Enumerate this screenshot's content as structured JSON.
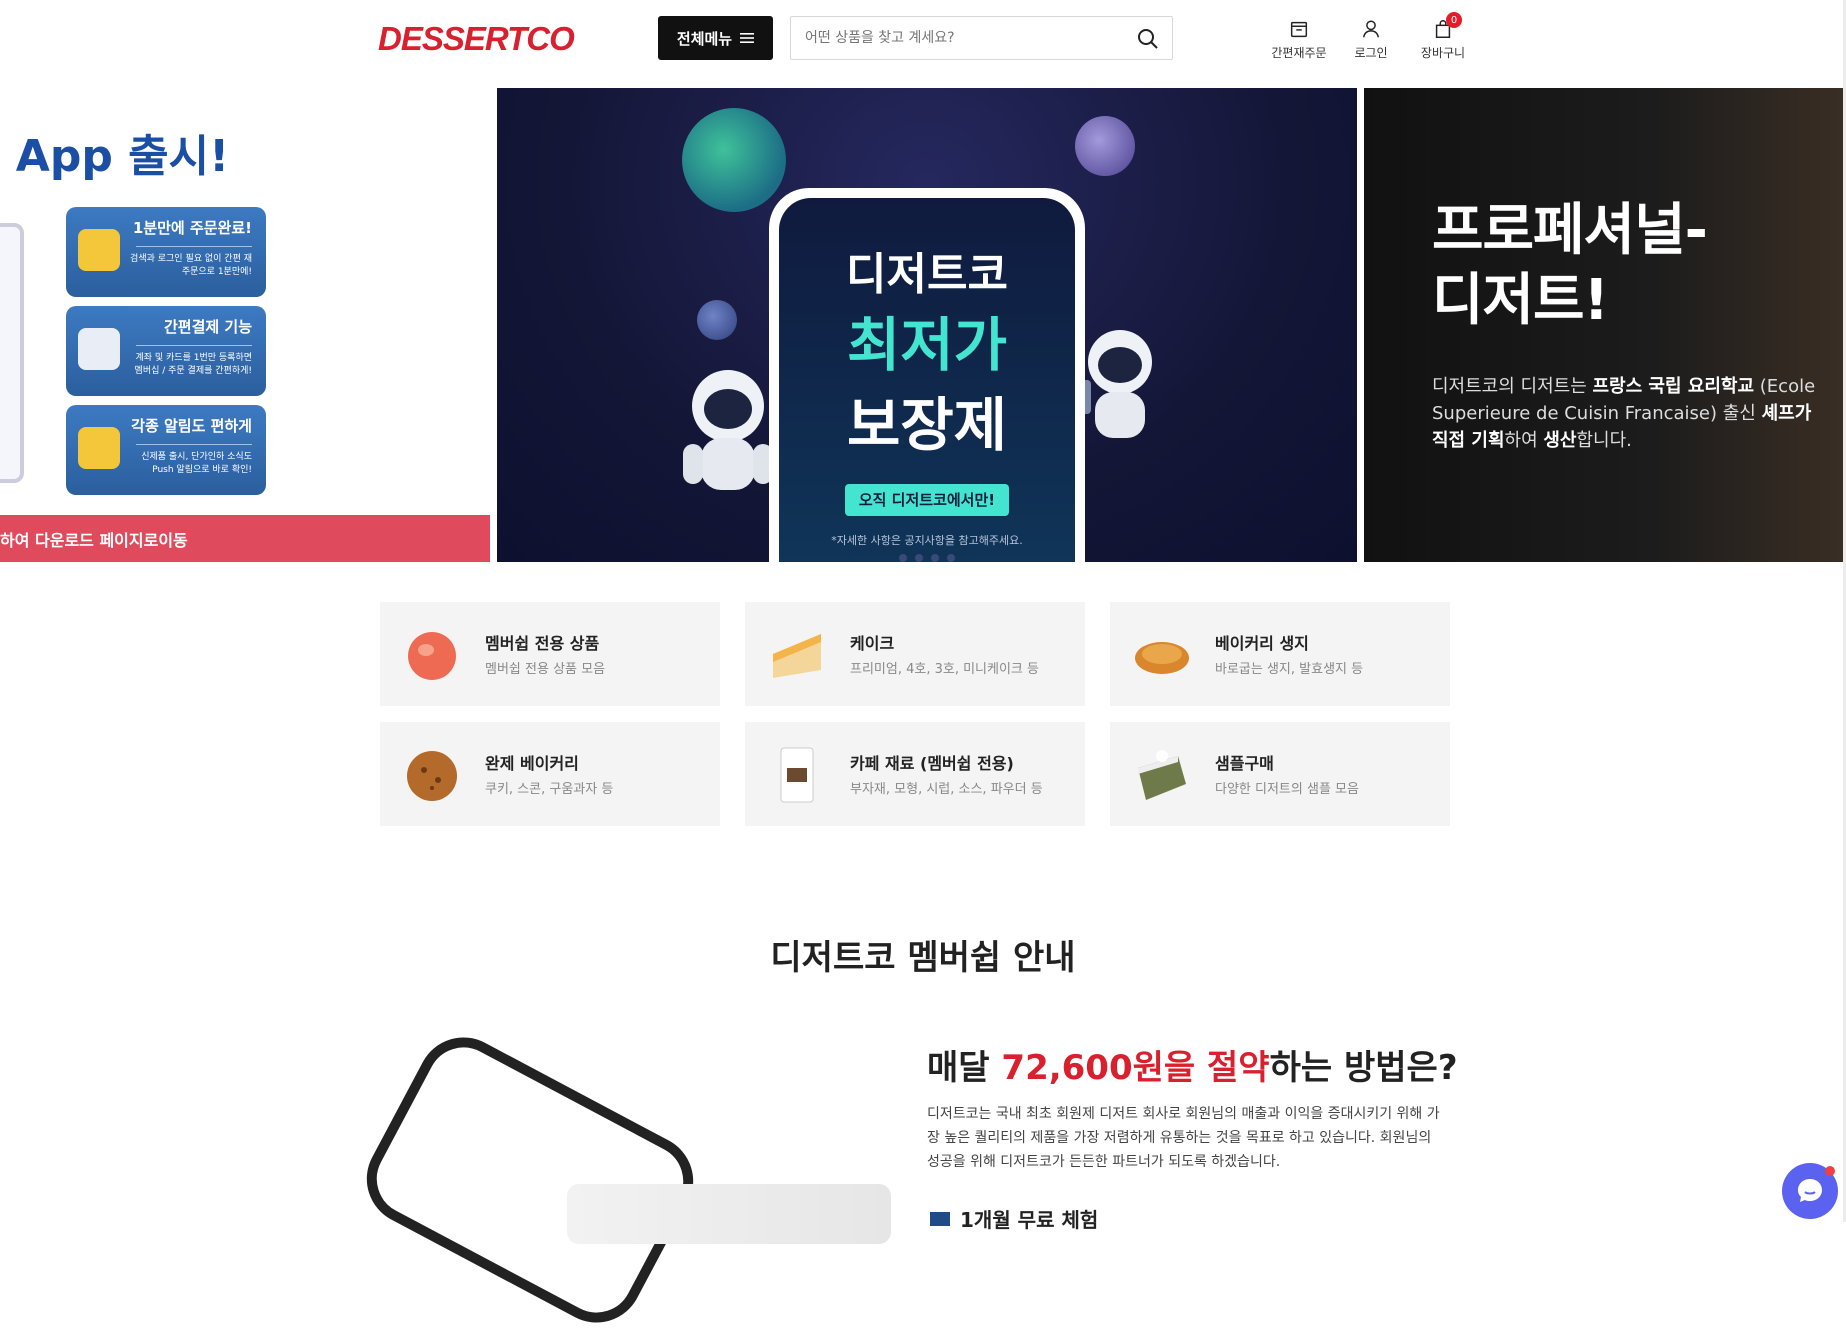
{
  "header": {
    "logo": "DESSERTCO",
    "menu_label": "전체메뉴",
    "search_placeholder": "어떤 상품을 찾고 계세요?",
    "icons": [
      {
        "label": "간편재주문",
        "icon": "box-icon"
      },
      {
        "label": "로그인",
        "icon": "user-icon"
      },
      {
        "label": "장바구니",
        "icon": "bag-icon"
      }
    ],
    "cart_count": "0"
  },
  "banner_left": {
    "title": "코 App 출시!",
    "features": [
      {
        "title": "1분만에 주문완료!",
        "desc": "검색과 로그인 필요 없이 간편 재주문으로 1분만에!"
      },
      {
        "title": "간편결제 기능",
        "desc": "계좌 및 카드를 1번만 등록하면 멤버십 / 주문 결제를 간편하게!"
      },
      {
        "title": "각종 알림도 편하게",
        "desc": "신제품 출시, 단가인하 소식도 Push 알림으로 바로 확인!"
      }
    ],
    "download": "하여 다운로드 페이지로이동"
  },
  "banner_mid": {
    "line1": "디저트코",
    "line2": "최저가",
    "line3": "보장제",
    "button": "오직 디저트코에서만!",
    "note": "*자세한 사항은 공지사항을 참고해주세요."
  },
  "banner_right": {
    "title1": "프로페셔널-",
    "title2": "디저트!",
    "desc_pre": "디저트코의 디저트는 ",
    "desc_b1": "프랑스 국립 요리학교",
    "desc_mid": " (Ecole Superieure de Cuisin Francaise) 출신 ",
    "desc_b2": "셰프가 직접 기획",
    "desc_mid2": "하여 ",
    "desc_b3": "생산",
    "desc_end": "합니다."
  },
  "categories": [
    {
      "name": "멤버쉽 전용 상품",
      "desc": "멤버쉽 전용 상품 모음"
    },
    {
      "name": "케이크",
      "desc": "프리미엄, 4호, 3호, 미니케이크 등"
    },
    {
      "name": "베이커리 생지",
      "desc": "바로굽는 생지, 발효생지 등"
    },
    {
      "name": "완제 베이커리",
      "desc": "쿠키, 스콘, 구움과자 등"
    },
    {
      "name": "카페 재료 (멤버쉽 전용)",
      "desc": "부자재, 모형, 시럽, 소스, 파우더 등"
    },
    {
      "name": "샘플구매",
      "desc": "다양한 디저트의 샘플 모음"
    }
  ],
  "membership": {
    "section_title": "디저트코 멤버쉽 안내",
    "head_pre": "매달 ",
    "head_red": "72,600원을 절약",
    "head_post": "하는 방법은?",
    "paragraph": "디저트코는 국내 최초 회원제 디저트 회사로 회원님의 매출과 이익을 증대시키기 위해 가장 높은 퀄리티의 제품을 가장 저렴하게 유통하는 것을 목표로 하고 있습니다. 회원님의 성공을 위해 디저트코가 든든한 파트너가 되도록 하겠습니다.",
    "sub": "1개월 무료 체험"
  }
}
